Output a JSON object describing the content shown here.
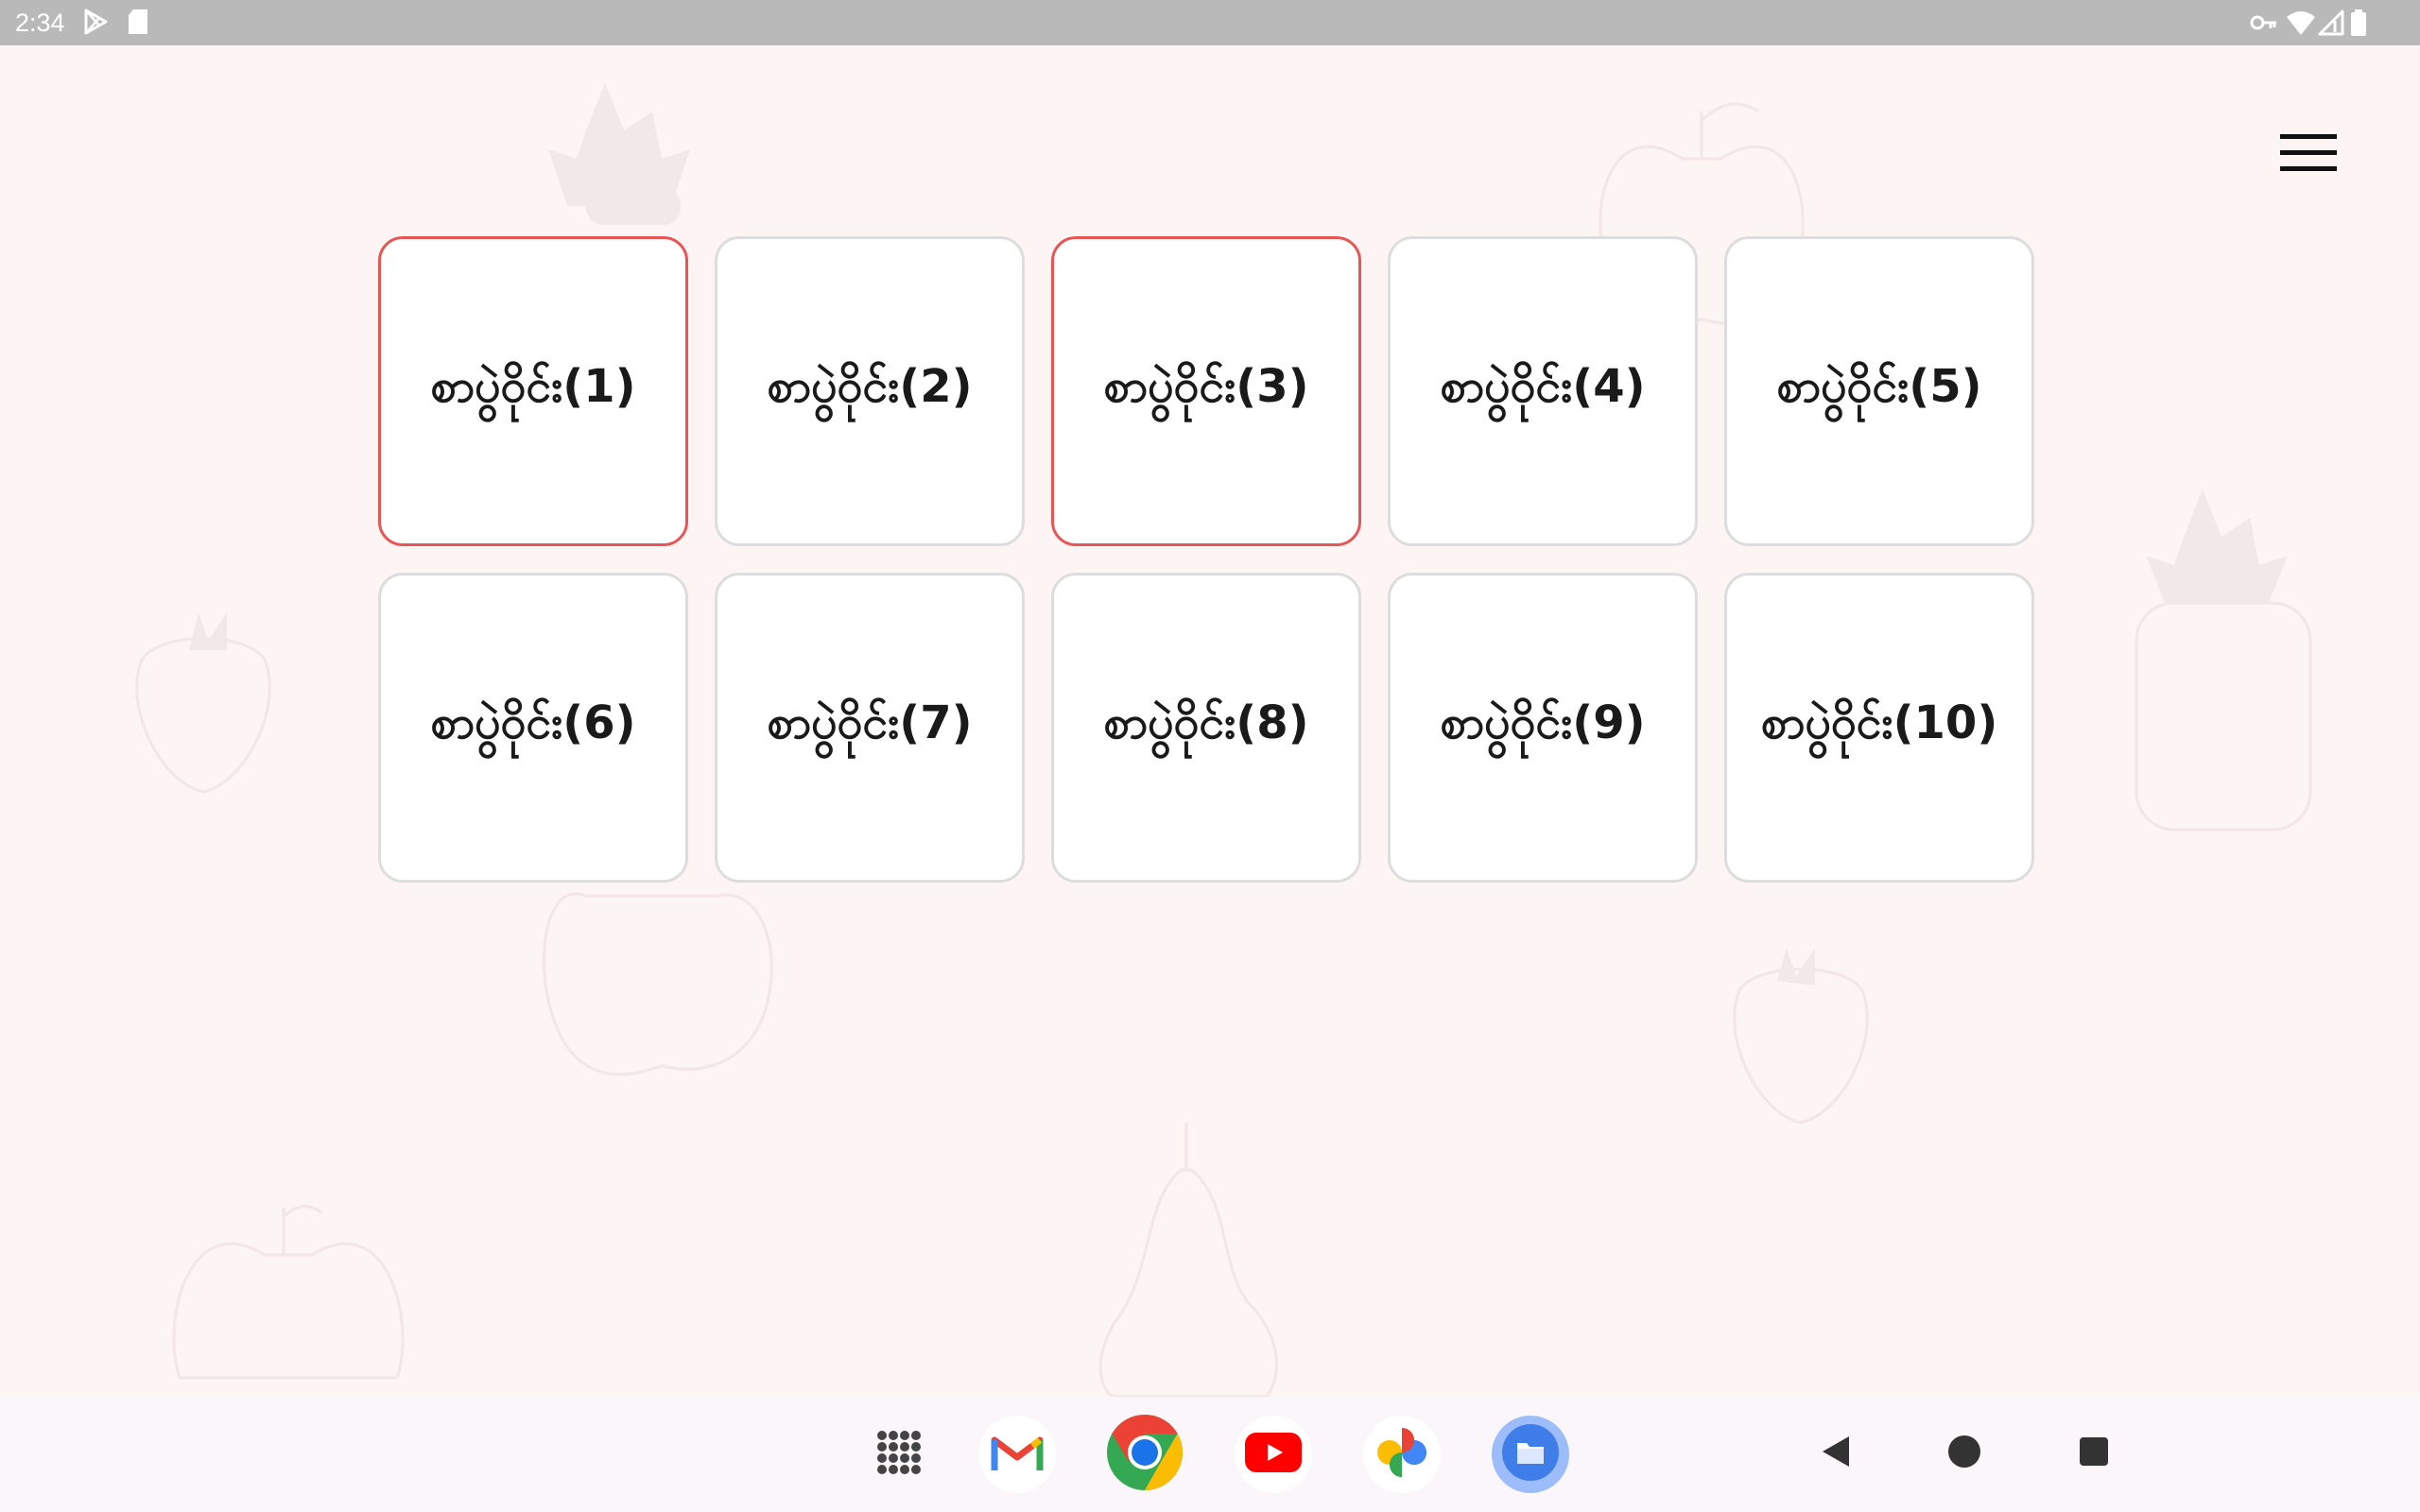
{
  "status_bar": {
    "time": "2:34",
    "left_icons": [
      "play-store-icon",
      "sd-card-icon"
    ],
    "right_icons": [
      "vpn-key-icon",
      "wifi-icon",
      "signal-icon",
      "battery-icon"
    ]
  },
  "menu": {
    "icon": "hamburger-menu-icon"
  },
  "cards": [
    {
      "label": "စာပွဲဝိုင်း(1)",
      "selected": true
    },
    {
      "label": "စာပွဲဝိုင်း(2)",
      "selected": false
    },
    {
      "label": "စာပွဲဝိုင်း(3)",
      "selected": true
    },
    {
      "label": "စာပွဲဝိုင်း(4)",
      "selected": false
    },
    {
      "label": "စာပွဲဝိုင်း(5)",
      "selected": false
    },
    {
      "label": "စာပွဲဝိုင်း(6)",
      "selected": false
    },
    {
      "label": "စာပွဲဝိုင်း(7)",
      "selected": false
    },
    {
      "label": "စာပွဲဝိုင်း(8)",
      "selected": false
    },
    {
      "label": "စာပွဲဝိုင်း(9)",
      "selected": false
    },
    {
      "label": "စာပွဲဝိုင်း(10)",
      "selected": false
    }
  ],
  "colors": {
    "selected_border": "#e85555",
    "card_border": "#dddddd",
    "background": "#fdf4f4",
    "status_bar": "#b9b9b9"
  },
  "dock": [
    {
      "name": "app-drawer",
      "icon": "apps-grid-icon"
    },
    {
      "name": "gmail",
      "icon": "gmail-icon"
    },
    {
      "name": "chrome",
      "icon": "chrome-icon"
    },
    {
      "name": "youtube",
      "icon": "youtube-icon"
    },
    {
      "name": "photos",
      "icon": "photos-icon"
    },
    {
      "name": "files",
      "icon": "files-icon"
    }
  ],
  "nav": [
    {
      "name": "back",
      "icon": "back-triangle-icon"
    },
    {
      "name": "home",
      "icon": "home-circle-icon"
    },
    {
      "name": "recents",
      "icon": "recents-square-icon"
    }
  ]
}
